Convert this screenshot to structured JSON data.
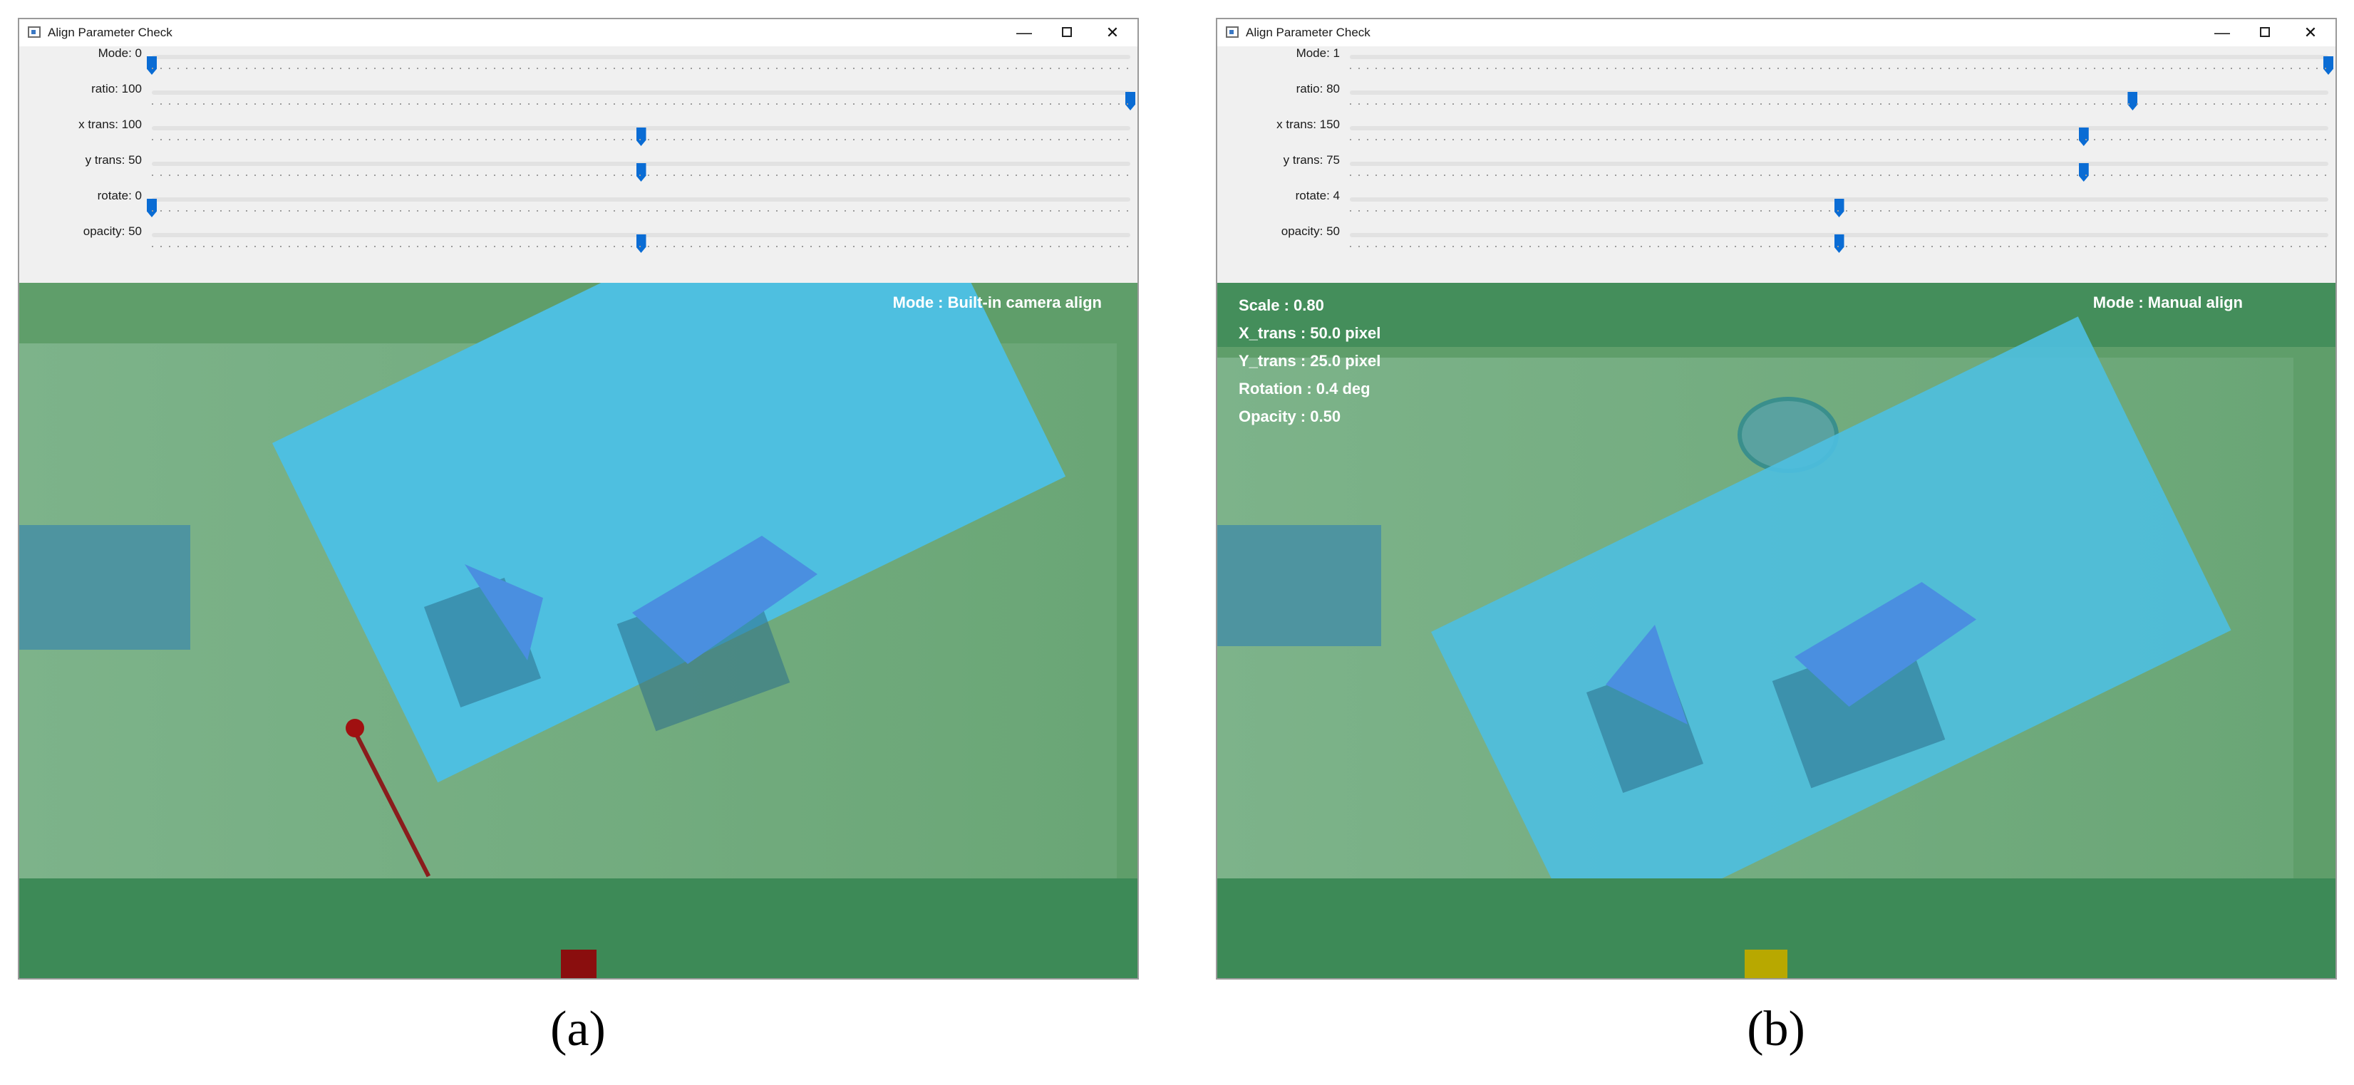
{
  "windows": [
    {
      "title": "Align Parameter Check",
      "sliders": [
        {
          "label": "Mode: 0",
          "value": 0,
          "max": 1
        },
        {
          "label": "ratio: 100",
          "value": 100,
          "max": 100
        },
        {
          "label": "x trans: 100",
          "value": 100,
          "max": 200
        },
        {
          "label": "y trans: 50",
          "value": 50,
          "max": 100
        },
        {
          "label": "rotate: 0",
          "value": 0,
          "max": 8
        },
        {
          "label": "opacity: 50",
          "value": 50,
          "max": 100
        }
      ],
      "mode_text": "Mode : Built-in camera align",
      "caption": "(a)"
    },
    {
      "title": "Align Parameter Check",
      "sliders": [
        {
          "label": "Mode: 1",
          "value": 1,
          "max": 1
        },
        {
          "label": "ratio: 80",
          "value": 80,
          "max": 100
        },
        {
          "label": "x trans: 150",
          "value": 150,
          "max": 200
        },
        {
          "label": "y trans: 75",
          "value": 75,
          "max": 100
        },
        {
          "label": "rotate: 4",
          "value": 4,
          "max": 8
        },
        {
          "label": "opacity: 50",
          "value": 50,
          "max": 100
        }
      ],
      "mode_text": "Mode : Manual align",
      "info": {
        "scale": "Scale : 0.80",
        "x_trans": "X_trans : 50.0 pixel",
        "y_trans": "Y_trans : 25.0 pixel",
        "rotation": "Rotation : 0.4 deg",
        "opacity": "Opacity : 0.50"
      },
      "caption": "(b)"
    }
  ],
  "titlebar_buttons": {
    "minimize": "—",
    "close": "✕"
  },
  "icons": [
    "window-app-icon",
    "minimize-icon",
    "maximize-icon",
    "close-icon",
    "slider-thumb-icon"
  ],
  "colors": {
    "slider_thumb": "#0a6cd4",
    "overlay_board": "#4ebfe0",
    "background_green": "#5f9e6a"
  }
}
